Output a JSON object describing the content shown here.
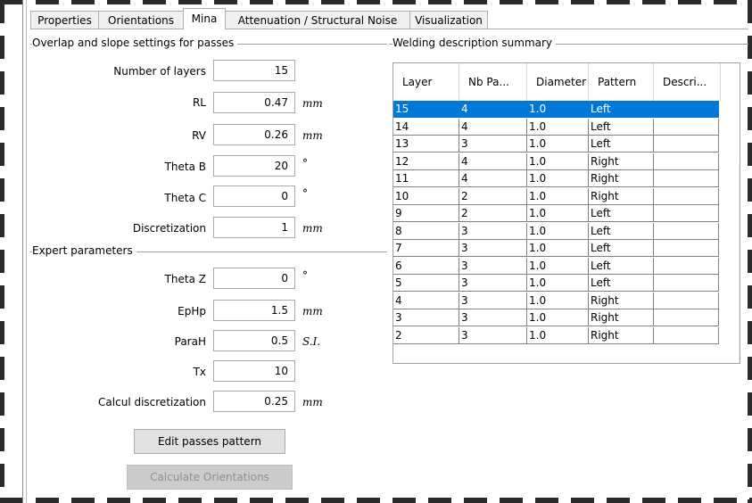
{
  "tabs": [
    "Properties",
    "Orientations",
    "Mina",
    "Attenuation / Structural Noise",
    "Visualization"
  ],
  "active_tab": "Mina",
  "overlap_group": {
    "title": "Overlap and slope settings for passes",
    "fields": [
      {
        "label": "Number of layers",
        "value": "15",
        "unit": ""
      },
      {
        "label": "RL",
        "value": "0.47",
        "unit": "mm"
      },
      {
        "label": "RV",
        "value": "0.26",
        "unit": "mm"
      },
      {
        "label": "Theta B",
        "value": "20",
        "unit": "°"
      },
      {
        "label": "Theta C",
        "value": "0",
        "unit": "°"
      },
      {
        "label": "Discretization",
        "value": "1",
        "unit": "mm"
      }
    ]
  },
  "expert_group": {
    "title": "Expert parameters",
    "fields": [
      {
        "label": "Theta Z",
        "value": "0",
        "unit": "°"
      },
      {
        "label": "EpHp",
        "value": "1.5",
        "unit": "mm"
      },
      {
        "label": "ParaH",
        "value": "0.5",
        "unit": "S.I."
      },
      {
        "label": "Tx",
        "value": "10",
        "unit": ""
      },
      {
        "label": "Calcul discretization",
        "value": "0.25",
        "unit": "mm"
      }
    ]
  },
  "buttons": {
    "edit_passes": "Edit passes pattern",
    "calculate": "Calculate Orientations"
  },
  "summary": {
    "title": "Welding description summary",
    "columns": [
      "Layer",
      "Nb Pa...",
      "Diameter",
      "Pattern",
      "Descri..."
    ],
    "rows": [
      [
        "15",
        "4",
        "1.0",
        "Left",
        ""
      ],
      [
        "14",
        "4",
        "1.0",
        "Left",
        ""
      ],
      [
        "13",
        "3",
        "1.0",
        "Left",
        ""
      ],
      [
        "12",
        "4",
        "1.0",
        "Right",
        ""
      ],
      [
        "11",
        "4",
        "1.0",
        "Right",
        ""
      ],
      [
        "10",
        "2",
        "1.0",
        "Right",
        ""
      ],
      [
        "9",
        "2",
        "1.0",
        "Left",
        ""
      ],
      [
        "8",
        "3",
        "1.0",
        "Left",
        ""
      ],
      [
        "7",
        "3",
        "1.0",
        "Left",
        ""
      ],
      [
        "6",
        "3",
        "1.0",
        "Left",
        ""
      ],
      [
        "5",
        "3",
        "1.0",
        "Left",
        ""
      ],
      [
        "4",
        "3",
        "1.0",
        "Right",
        ""
      ],
      [
        "3",
        "3",
        "1.0",
        "Right",
        ""
      ],
      [
        "2",
        "3",
        "1.0",
        "Right",
        ""
      ]
    ],
    "selected_row": 0
  },
  "colors": {
    "selection": "#0078d7"
  },
  "icons": {
    "scroll_up": "chevron-up-icon",
    "scroll_down": "chevron-down-icon"
  }
}
